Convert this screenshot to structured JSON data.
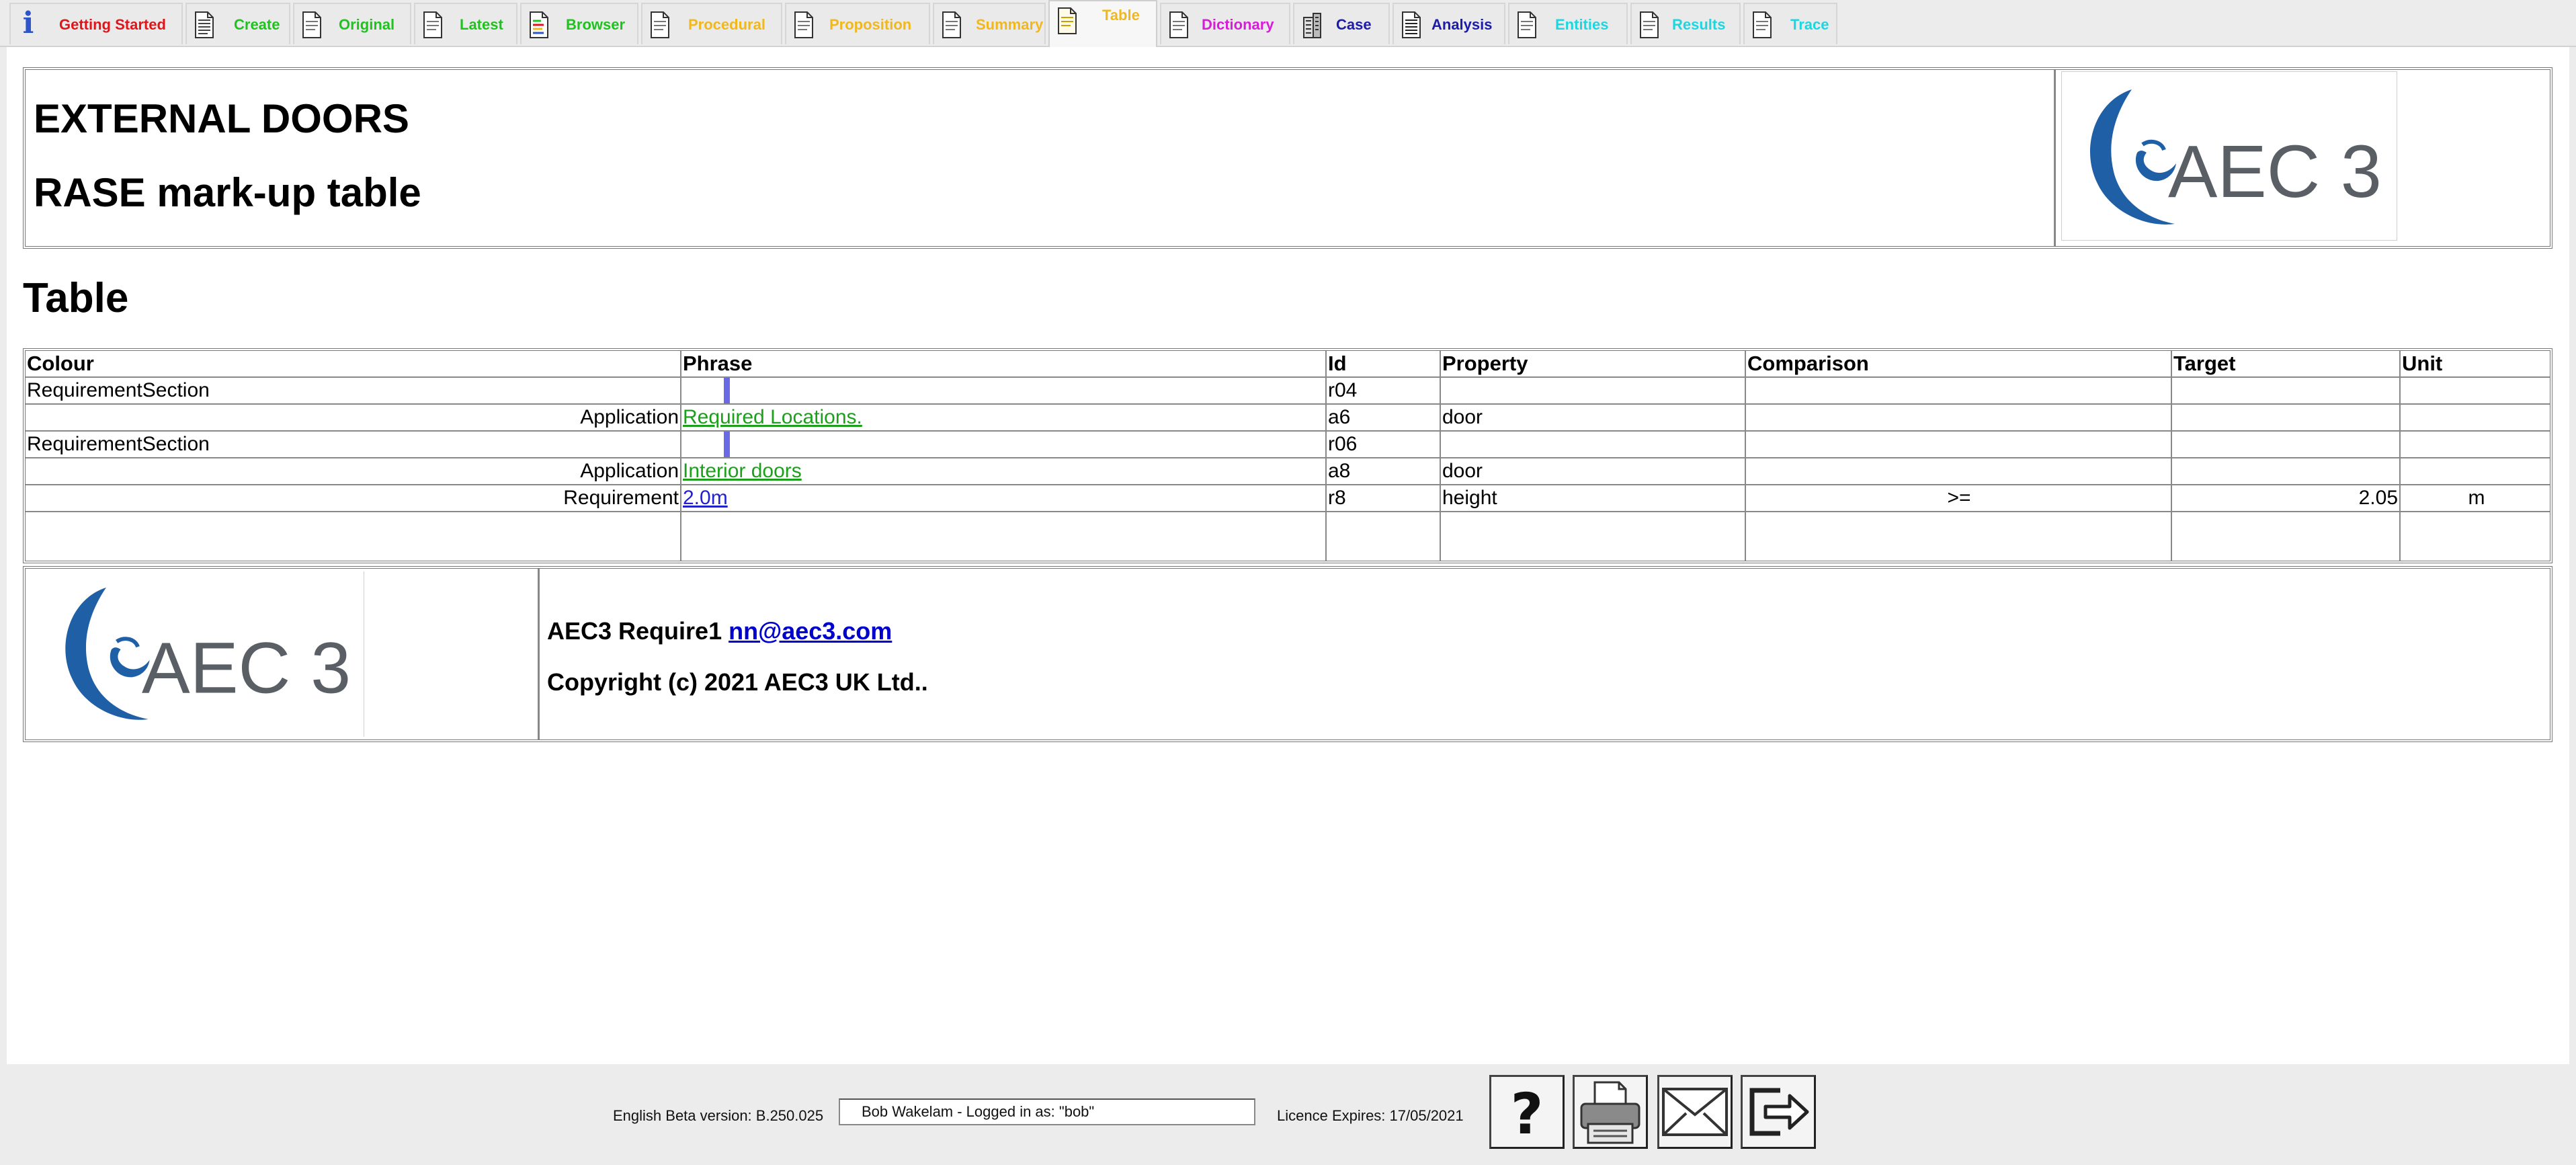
{
  "tabs": [
    {
      "label": "Getting Started",
      "color": "#e0151b",
      "icon": "info-icon",
      "active": false
    },
    {
      "label": "Create",
      "color": "#1ec31e",
      "icon": "document-icon",
      "active": false
    },
    {
      "label": "Original",
      "color": "#1ec31e",
      "icon": "document-icon",
      "active": false
    },
    {
      "label": "Latest",
      "color": "#1ec31e",
      "icon": "document-icon",
      "active": false
    },
    {
      "label": "Browser",
      "color": "#1ec31e",
      "icon": "document-colored-icon",
      "active": false
    },
    {
      "label": "Procedural",
      "color": "#f0b81e",
      "icon": "document-icon",
      "active": false
    },
    {
      "label": "Proposition",
      "color": "#f0b81e",
      "icon": "document-icon",
      "active": false
    },
    {
      "label": "Summary",
      "color": "#f0b81e",
      "icon": "document-icon",
      "active": false
    },
    {
      "label": "Table",
      "color": "#f0b81e",
      "icon": "document-icon",
      "active": true
    },
    {
      "label": "Dictionary",
      "color": "#d61ed6",
      "icon": "document-icon",
      "active": false
    },
    {
      "label": "Case",
      "color": "#1c1ca8",
      "icon": "building-icon",
      "active": false
    },
    {
      "label": "Analysis",
      "color": "#1c1ca8",
      "icon": "document-chart-icon",
      "active": false
    },
    {
      "label": "Entities",
      "color": "#1ed6e0",
      "icon": "document-icon",
      "active": false
    },
    {
      "label": "Results",
      "color": "#1ed6e0",
      "icon": "document-icon",
      "active": false
    },
    {
      "label": "Trace",
      "color": "#1ed6e0",
      "icon": "document-icon",
      "active": false
    }
  ],
  "header": {
    "title": "EXTERNAL DOORS",
    "subtitle": "RASE mark-up table",
    "logo_text": "AEC 3"
  },
  "section_title": "Table",
  "table": {
    "columns": [
      "Colour",
      "Phrase",
      "Id",
      "Property",
      "Comparison",
      "Target",
      "Unit"
    ],
    "rows": [
      {
        "colour": "RequirementSection",
        "phrase": "",
        "id": "r04",
        "property": "",
        "comparison": "",
        "target": "",
        "unit": "",
        "marker": true
      },
      {
        "colour": "Application",
        "phrase": "Required Locations.",
        "id": "a6",
        "property": "door",
        "comparison": "",
        "target": "",
        "unit": "",
        "marker": false
      },
      {
        "colour": "RequirementSection",
        "phrase": "",
        "id": "r06",
        "property": "",
        "comparison": "",
        "target": "",
        "unit": "",
        "marker": true
      },
      {
        "colour": "Application",
        "phrase": "Interior doors",
        "id": "a8",
        "property": "door",
        "comparison": "",
        "target": "",
        "unit": "",
        "marker": false
      },
      {
        "colour": "Requirement",
        "phrase": "2.0m",
        "id": "r8",
        "property": "height",
        "comparison": ">=",
        "target": "2.05",
        "unit": "m",
        "marker": false
      }
    ],
    "colors": {
      "application_link": "#1ca01c",
      "requirement_link": "#2222cc",
      "section_marker": "#6a6ae6"
    }
  },
  "footer": {
    "product": "AEC3 Require1",
    "email": "nn@aec3.com",
    "copyright": "Copyright (c) 2021 AEC3 UK Ltd..",
    "logo_text": "AEC 3"
  },
  "status_bar": {
    "version": "English Beta version: B.250.025",
    "user_field": "Bob Wakelam    -    Logged in as:    \"bob\"",
    "licence": "Licence Expires: 17/05/2021",
    "buttons": [
      {
        "name": "help-button",
        "icon": "question-mark-icon"
      },
      {
        "name": "print-button",
        "icon": "printer-icon"
      },
      {
        "name": "email-button",
        "icon": "envelope-icon"
      },
      {
        "name": "logout-button",
        "icon": "exit-arrow-icon"
      }
    ]
  },
  "brand_colors": {
    "logo_blue": "#1f5fa6",
    "logo_grey": "#5a5f66"
  }
}
